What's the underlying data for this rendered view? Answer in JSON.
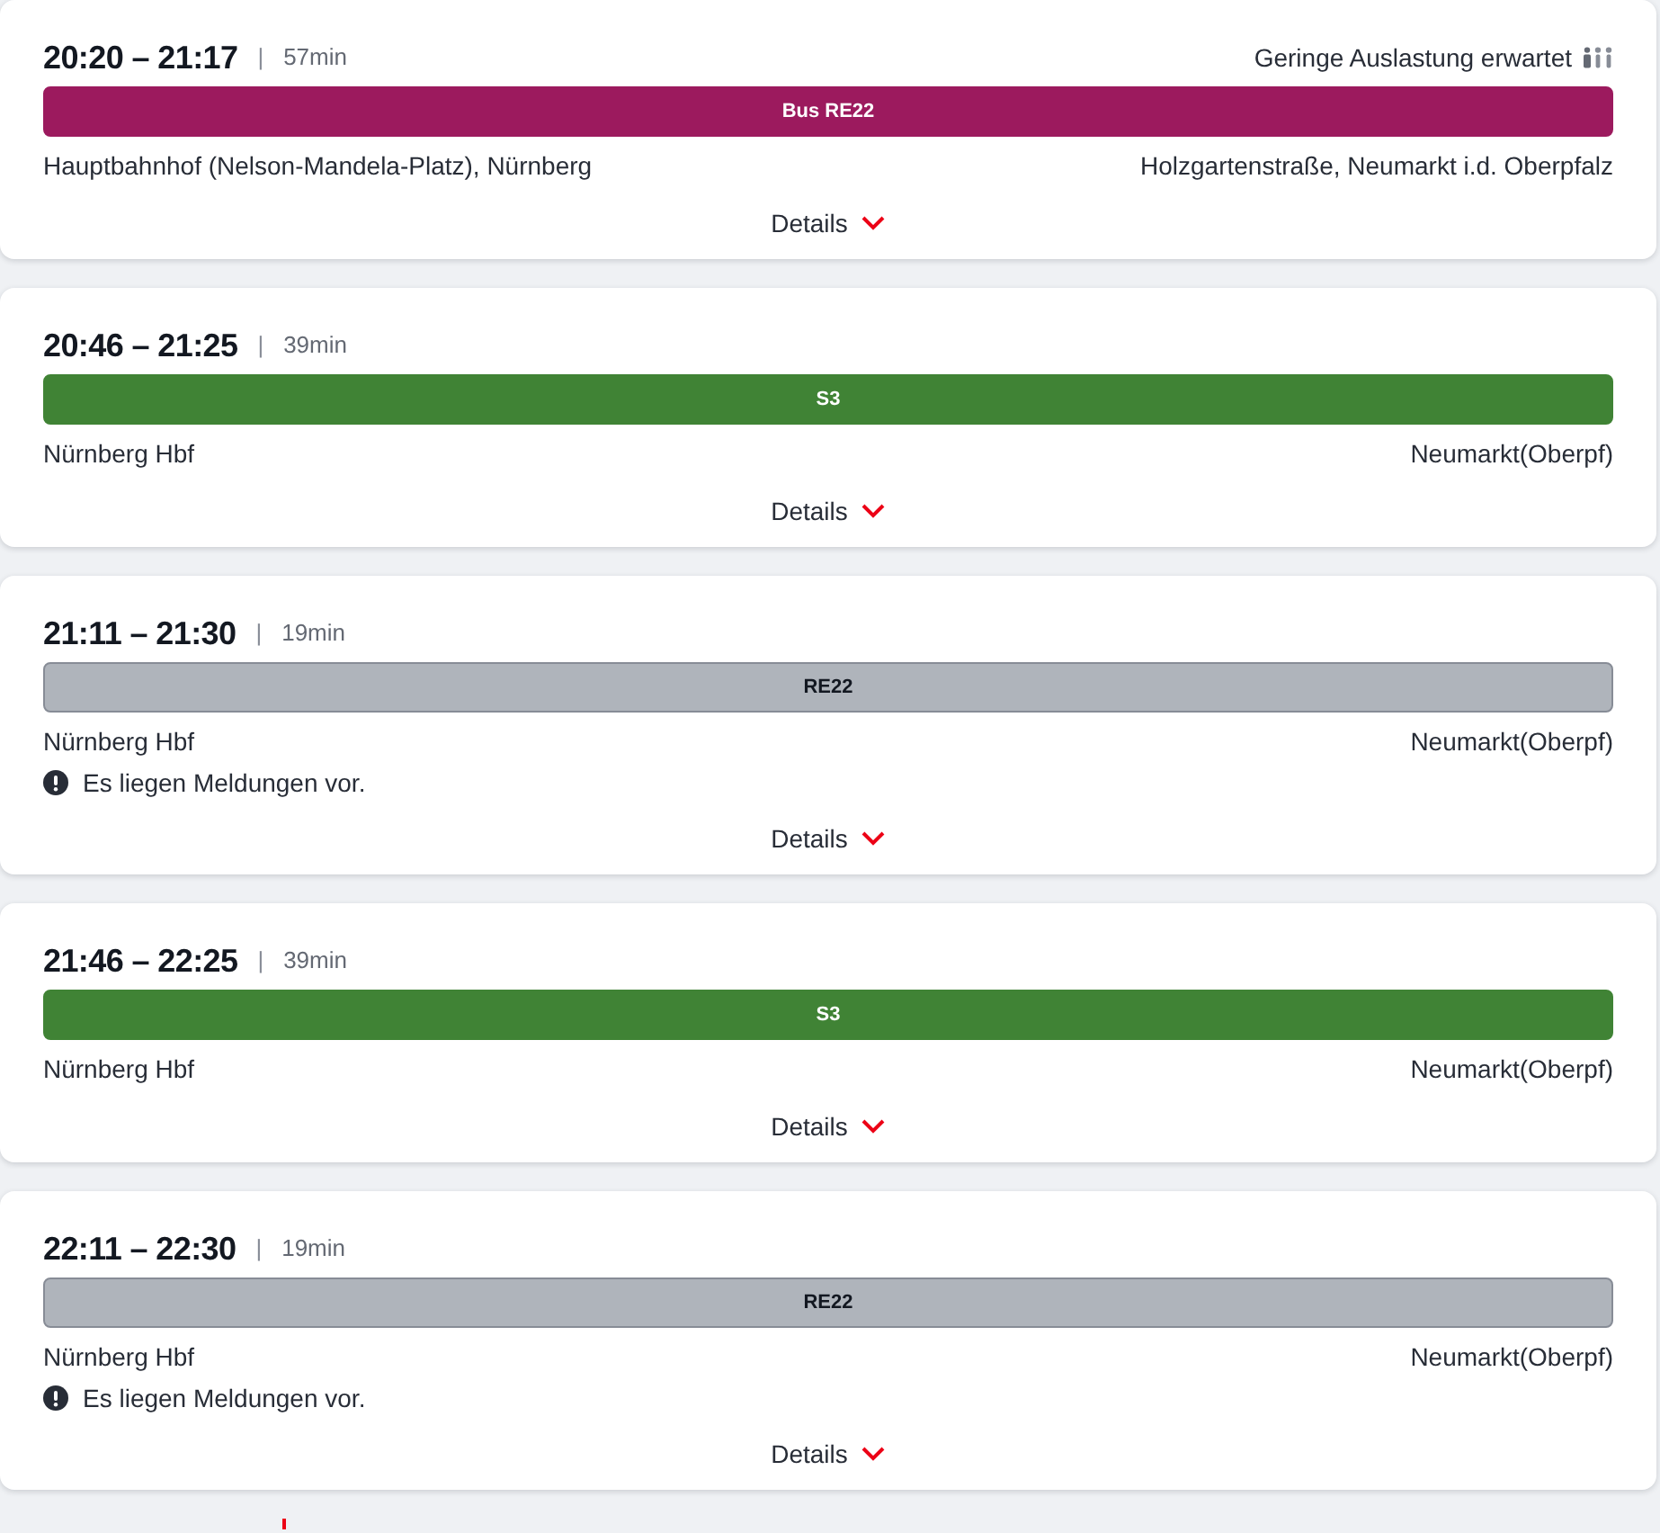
{
  "connections": [
    {
      "times": "20:20 – 21:17",
      "separator": "|",
      "duration": "57min",
      "occupancy": "Geringe Auslastung erwartet",
      "line": {
        "kind": "bus",
        "label": "Bus RE22"
      },
      "from": "Hauptbahnhof (Nelson-Mandela-Platz), Nürnberg",
      "to": "Holzgartenstraße, Neumarkt i.d. Oberpfalz",
      "details": "Details"
    },
    {
      "times": "20:46 – 21:25",
      "separator": "|",
      "duration": "39min",
      "line": {
        "kind": "sbahn",
        "label": "S3"
      },
      "from": "Nürnberg Hbf",
      "to": "Neumarkt(Oberpf)",
      "details": "Details"
    },
    {
      "times": "21:11 – 21:30",
      "separator": "|",
      "duration": "19min",
      "line": {
        "kind": "regional",
        "label": "RE22"
      },
      "from": "Nürnberg Hbf",
      "to": "Neumarkt(Oberpf)",
      "notice": "Es liegen Meldungen vor.",
      "details": "Details"
    },
    {
      "times": "21:46 – 22:25",
      "separator": "|",
      "duration": "39min",
      "line": {
        "kind": "sbahn",
        "label": "S3"
      },
      "from": "Nürnberg Hbf",
      "to": "Neumarkt(Oberpf)",
      "details": "Details"
    },
    {
      "times": "22:11 – 22:30",
      "separator": "|",
      "duration": "19min",
      "line": {
        "kind": "regional",
        "label": "RE22"
      },
      "from": "Nürnberg Hbf",
      "to": "Neumarkt(Oberpf)",
      "notice": "Es liegen Meldungen vor.",
      "details": "Details"
    }
  ]
}
